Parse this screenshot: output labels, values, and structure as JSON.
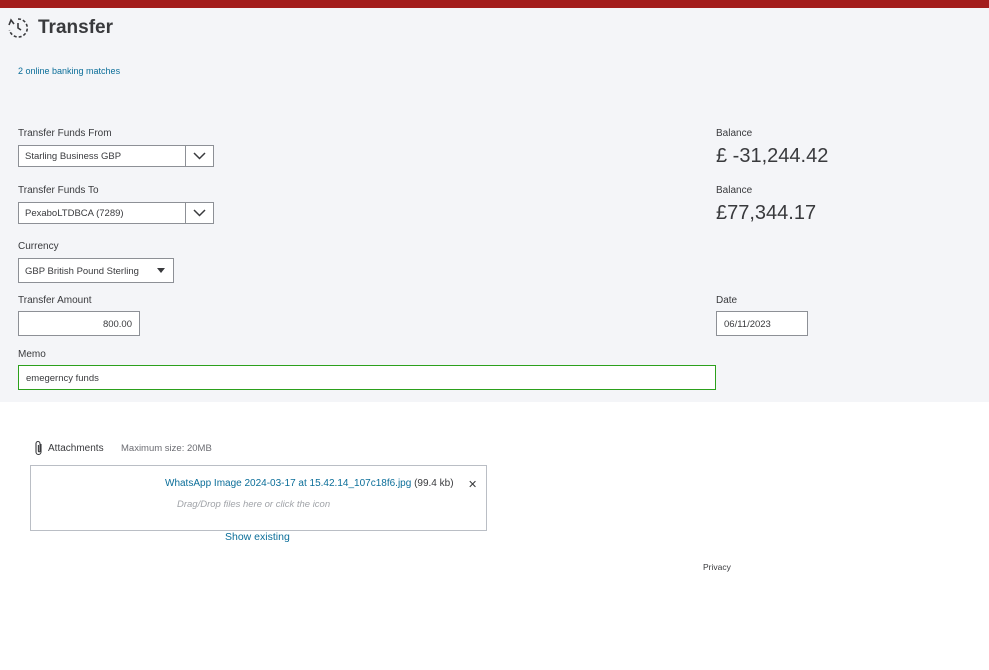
{
  "header": {
    "title": "Transfer",
    "icon": "transfer-recurring-icon",
    "accent_color": "#a31c1c"
  },
  "banking": {
    "matches_link": "2 online banking matches"
  },
  "from": {
    "label": "Transfer Funds From",
    "value": "Starling Business GBP",
    "balance_label": "Balance",
    "balance": "£ -31,244.42"
  },
  "to": {
    "label": "Transfer Funds To",
    "value": "PexaboLTDBCA (7289)",
    "balance_label": "Balance",
    "balance": "£77,344.17"
  },
  "currency": {
    "label": "Currency",
    "value": "GBP British Pound Sterling"
  },
  "amount": {
    "label": "Transfer Amount",
    "value": "800.00"
  },
  "date": {
    "label": "Date",
    "value": "06/11/2023"
  },
  "memo": {
    "label": "Memo",
    "value": "emegerncy funds"
  },
  "attachments": {
    "label": "Attachments",
    "max_size": "Maximum size: 20MB",
    "file_name": "WhatsApp Image 2024-03-17 at 15.42.14_107c18f6.jpg",
    "file_size": "(99.4 kb)",
    "remove_glyph": "✕",
    "drag_hint": "Drag/Drop files here or click the icon",
    "show_existing": "Show existing"
  },
  "footer": {
    "privacy": "Privacy"
  }
}
